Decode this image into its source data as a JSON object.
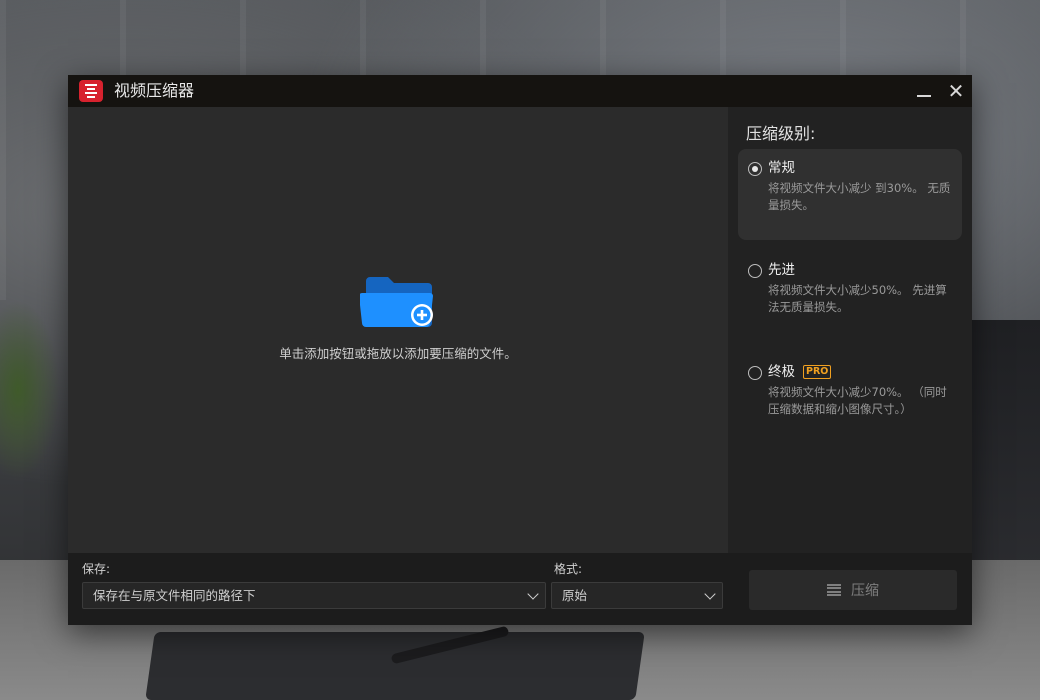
{
  "window": {
    "title": "视频压缩器",
    "minimize_glyph": "—",
    "close_glyph": "✕"
  },
  "drop_area": {
    "hint": "单击添加按钮或拖放以添加要压缩的文件。",
    "icon": "folder-add-icon"
  },
  "compression": {
    "title": "压缩级别:",
    "options": [
      {
        "name": "常规",
        "description": "将视频文件大小减少 到30%。 无质量损失。",
        "selected": true
      },
      {
        "name": "先进",
        "description": "将视频文件大小减少50%。 先进算法无质量损失。",
        "selected": false
      },
      {
        "name": "终极",
        "badge": "PRO",
        "description": "将视频文件大小减少70%。 （同时压缩数据和缩小图像尺寸。）",
        "selected": false
      }
    ]
  },
  "bottom": {
    "save_label": "保存:",
    "save_value": "保存在与原文件相同的路径下",
    "format_label": "格式:",
    "format_value": "原始",
    "compress_button": "压缩"
  },
  "colors": {
    "brand": "#d7222e",
    "folder": "#1e90ff",
    "pro": "#f0a020"
  }
}
